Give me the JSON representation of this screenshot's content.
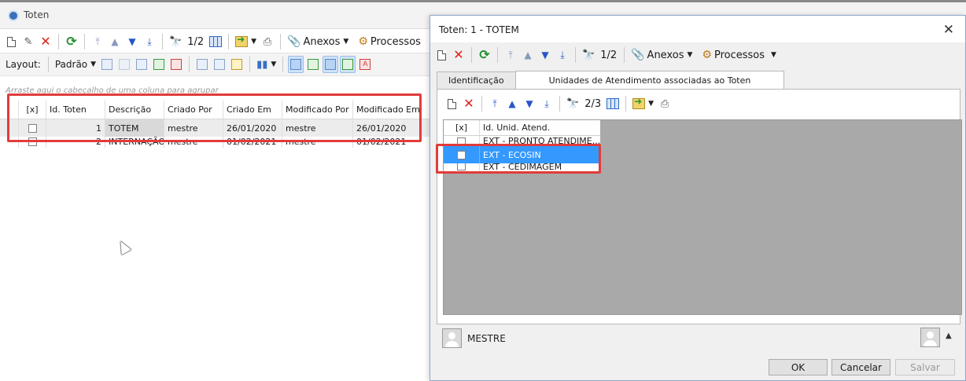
{
  "main": {
    "title": "Toten",
    "toolbar1": {
      "page": "1/2",
      "attachments_label": "Anexos",
      "processes_label": "Processos"
    },
    "toolbar2": {
      "layout_label": "Layout:",
      "layout_value": "Padrão"
    },
    "group_hint": "Arraste aqui o cabeçalho de uma coluna para agrupar",
    "grid": {
      "columns": [
        "[x]",
        "Id. Toten",
        "Descrição",
        "Criado Por",
        "Criado Em",
        "Modificado Por",
        "Modificado Em"
      ],
      "rows": [
        {
          "id": "1",
          "descricao": "TOTEM",
          "criado_por": "mestre",
          "criado_em": "26/01/2020",
          "modificado_por": "mestre",
          "modificado_em": "26/01/2020"
        },
        {
          "id": "2",
          "descricao": "INTERNAÇÃO",
          "criado_por": "mestre",
          "criado_em": "01/02/2021",
          "modificado_por": "mestre",
          "modificado_em": "01/02/2021"
        }
      ]
    }
  },
  "dialog": {
    "title": "Toten: 1 - TOTEM",
    "toolbar": {
      "page": "1/2",
      "attachments_label": "Anexos",
      "processes_label": "Processos"
    },
    "tabs": [
      "Identificação",
      "Unidades de Atendimento associadas ao Toten"
    ],
    "sub_toolbar": {
      "page": "2/3"
    },
    "sub_grid": {
      "columns": [
        "[x]",
        "Id. Unid. Atend."
      ],
      "rows": [
        "EXT - PRONTO ATENDIME...",
        "EXT - ECOSIN",
        "EXT - CEDIMAGEM"
      ]
    },
    "user": "MESTRE",
    "buttons": {
      "ok": "OK",
      "cancel": "Cancelar",
      "save": "Salvar"
    }
  },
  "colors": {
    "highlight_red": "#e23b3b",
    "selection_blue": "#3399ff",
    "grid_background": "#a9a9a9"
  }
}
